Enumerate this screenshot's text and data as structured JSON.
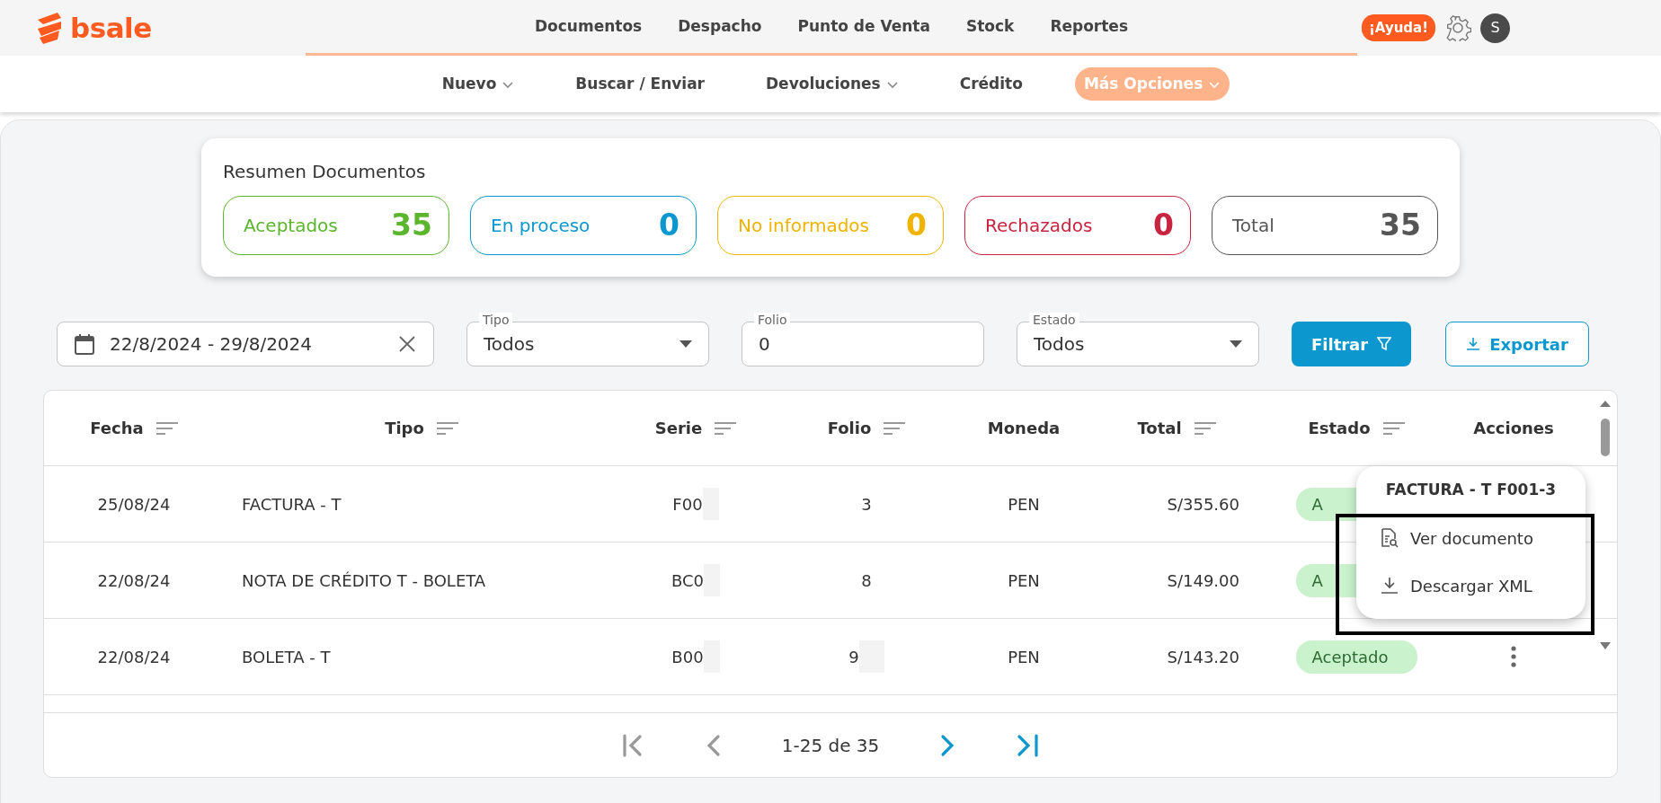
{
  "logo": {
    "text": "bsale"
  },
  "top_nav": [
    {
      "label": "Documentos"
    },
    {
      "label": "Despacho"
    },
    {
      "label": "Punto de Venta"
    },
    {
      "label": "Stock"
    },
    {
      "label": "Reportes"
    }
  ],
  "help_button": "¡Ayuda!",
  "avatar": "S",
  "sub_nav": [
    {
      "label": "Nuevo",
      "has_menu": true,
      "selected": false
    },
    {
      "label": "Buscar / Enviar",
      "has_menu": false,
      "selected": false
    },
    {
      "label": "Devoluciones",
      "has_menu": true,
      "selected": false
    },
    {
      "label": "Crédito",
      "has_menu": false,
      "selected": false
    },
    {
      "label": "Más Opciones",
      "has_menu": true,
      "selected": true
    }
  ],
  "summary": {
    "title": "Resumen Documentos",
    "items": [
      {
        "label": "Aceptados",
        "count": "35",
        "color": "#5bb52d"
      },
      {
        "label": "En proceso",
        "count": "0",
        "color": "#0c98cf"
      },
      {
        "label": "No informados",
        "count": "0",
        "color": "#efb300"
      },
      {
        "label": "Rechazados",
        "count": "0",
        "color": "#c8233f"
      },
      {
        "label": "Total",
        "count": "35",
        "color": "#555555"
      }
    ]
  },
  "filters": {
    "date_range": "22/8/2024 - 29/8/2024",
    "tipo": {
      "label": "Tipo",
      "value": "Todos"
    },
    "folio": {
      "label": "Folio",
      "value": "0"
    },
    "estado": {
      "label": "Estado",
      "value": "Todos"
    },
    "filter_button": "Filtrar",
    "export_button": "Exportar"
  },
  "table": {
    "columns": [
      {
        "label": "Fecha",
        "sortable": true
      },
      {
        "label": "Tipo",
        "sortable": true
      },
      {
        "label": "Serie",
        "sortable": true
      },
      {
        "label": "Folio",
        "sortable": true
      },
      {
        "label": "Moneda",
        "sortable": false
      },
      {
        "label": "Total",
        "sortable": true
      },
      {
        "label": "Estado",
        "sortable": true
      },
      {
        "label": "Acciones",
        "sortable": false
      }
    ],
    "rows": [
      {
        "fecha": "25/08/24",
        "tipo": "FACTURA - T",
        "serie": "F00",
        "serie_redacted": true,
        "folio": "3",
        "folio_redacted": false,
        "moneda": "PEN",
        "total": "S/355.60",
        "estado": "A",
        "actions_visible": false
      },
      {
        "fecha": "22/08/24",
        "tipo": "NOTA DE CRÉDITO T - BOLETA",
        "serie": "BC0",
        "serie_redacted": true,
        "folio": "8",
        "folio_redacted": false,
        "moneda": "PEN",
        "total": "S/149.00",
        "estado": "A",
        "actions_visible": false
      },
      {
        "fecha": "22/08/24",
        "tipo": "BOLETA - T",
        "serie": "B00",
        "serie_redacted": true,
        "folio": "9",
        "folio_redacted": true,
        "moneda": "PEN",
        "total": "S/143.20",
        "estado": "Aceptado",
        "actions_visible": true
      }
    ]
  },
  "pagination": {
    "text": "1-25 de 35",
    "first_disabled": true,
    "prev_disabled": true,
    "next_disabled": false,
    "last_disabled": false
  },
  "action_menu": {
    "title": "FACTURA - T F001-3",
    "highlighted": true,
    "items": [
      {
        "label": "Ver documento",
        "kind": "view"
      },
      {
        "label": "Descargar XML",
        "kind": "download"
      }
    ]
  }
}
